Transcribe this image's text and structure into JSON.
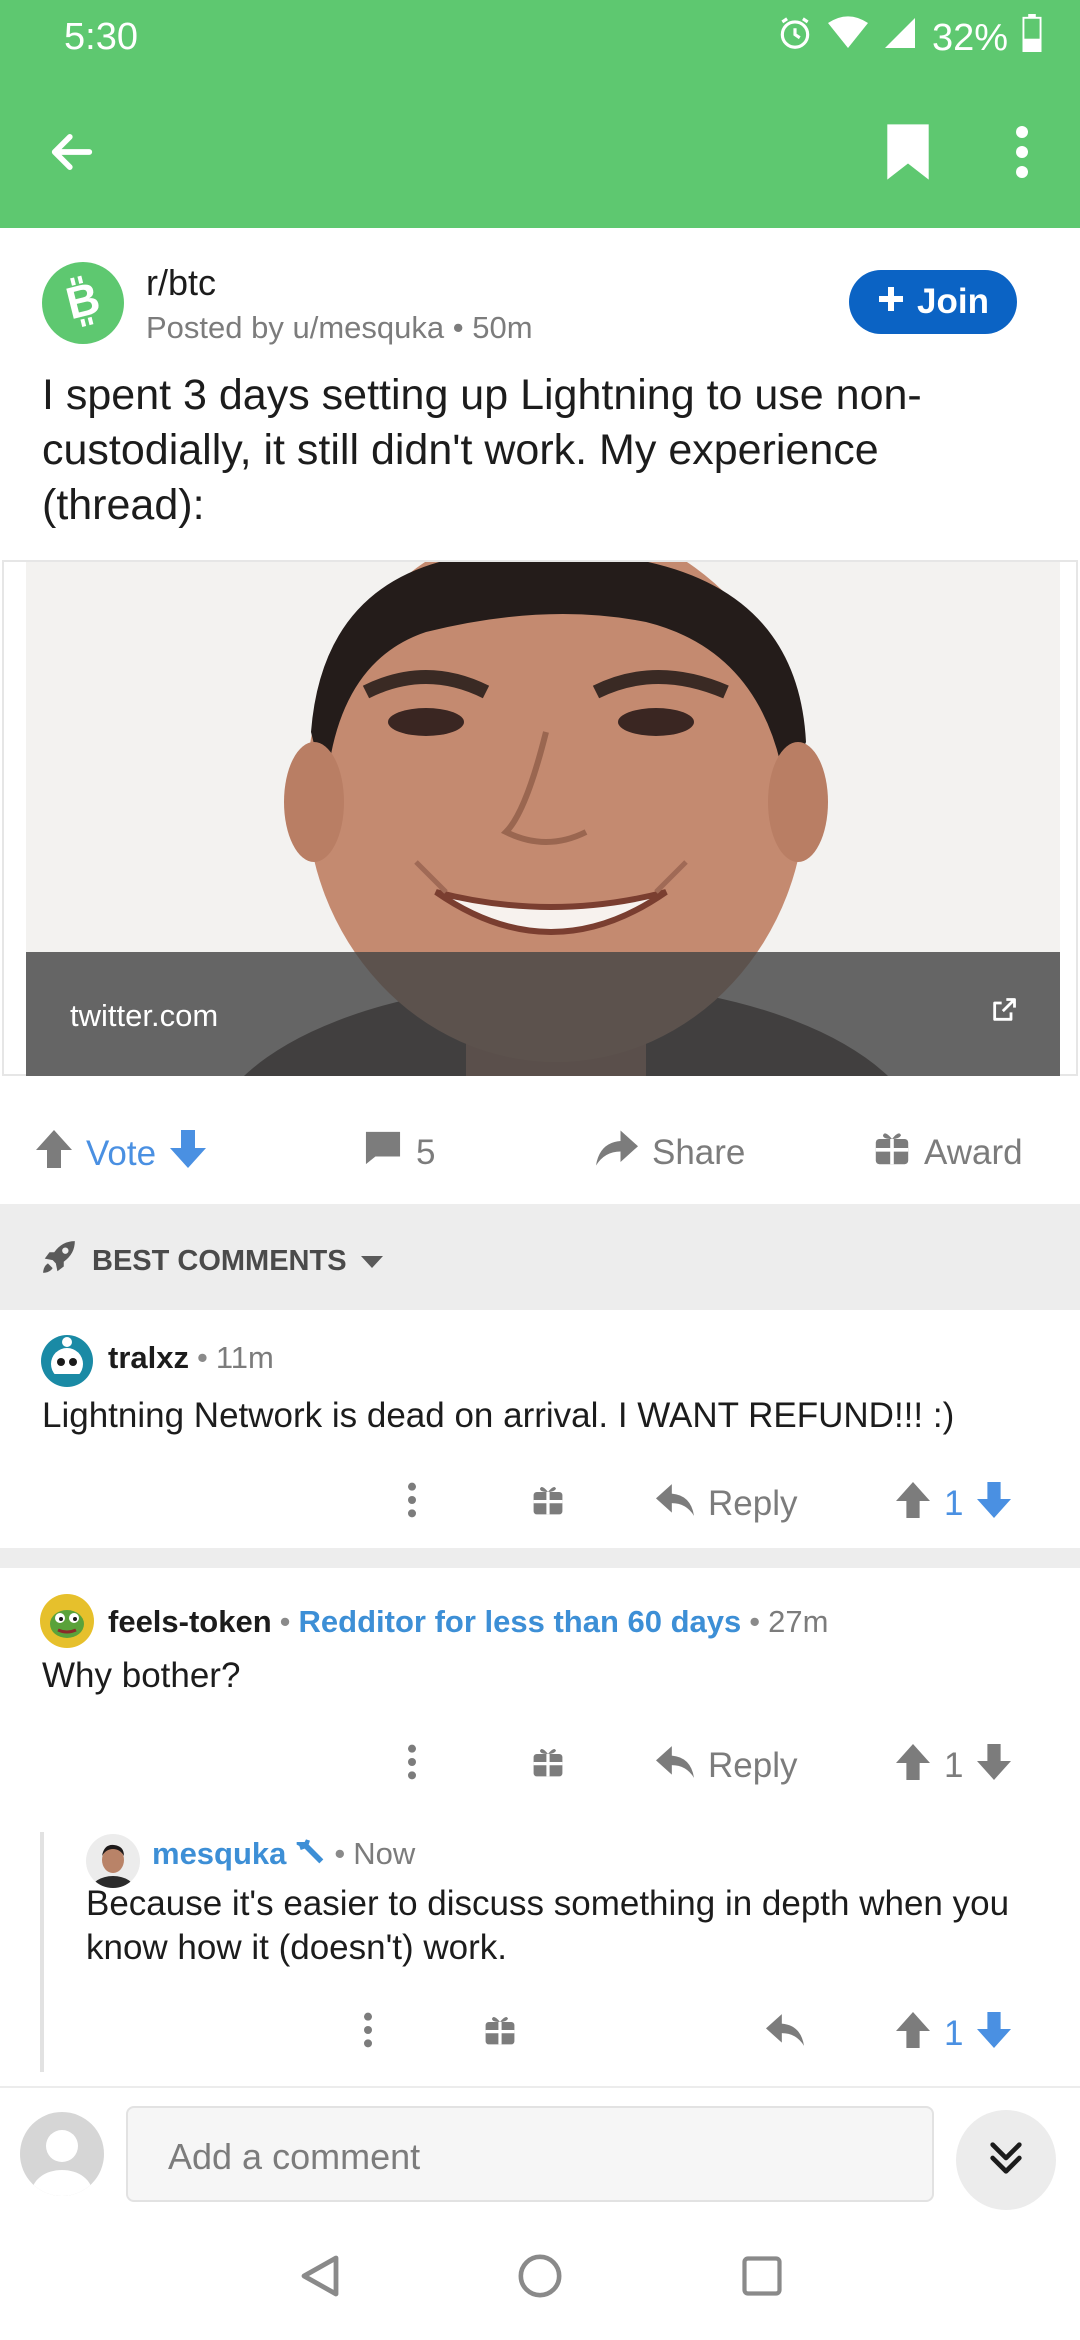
{
  "status_bar": {
    "time": "5:30",
    "battery": "32%",
    "icons": [
      "alarm-icon",
      "wifi-icon",
      "signal-icon",
      "battery-icon"
    ]
  },
  "toolbar": {
    "back_icon": "arrow-left-icon",
    "bookmark_icon": "bookmark-icon",
    "more_icon": "kebab-menu-icon",
    "background": "#5ec870"
  },
  "post": {
    "subreddit": "r/btc",
    "posted_by": "Posted by u/mesquka",
    "age": "50m",
    "join_label": "Join",
    "title": "I spent 3 days setting up Lightning to use non-custodially, it still didn't work. My experience (thread):",
    "link_domain": "twitter.com",
    "vote_label": "Vote",
    "comment_count": "5",
    "share_label": "Share",
    "award_label": "Award"
  },
  "sort": {
    "label": "BEST COMMENTS"
  },
  "comments": [
    {
      "author": "tralxz",
      "age": "11m",
      "body": "Lightning Network is dead on arrival. I WANT REFUND!!! :)",
      "reply_label": "Reply",
      "score": "1"
    },
    {
      "author": "feels-token",
      "flair": "Redditor for less than 60 days",
      "age": "27m",
      "body": "Why bother?",
      "reply_label": "Reply",
      "score": "1"
    },
    {
      "author": "mesquka",
      "age": "Now",
      "body": "Because it's easier to discuss something in depth when you know how it (doesn't) work.",
      "score": "1"
    }
  ],
  "composer": {
    "placeholder": "Add a comment"
  },
  "colors": {
    "accent_green": "#5ec870",
    "join_blue": "#0b63c4",
    "vote_blue": "#4a90e2",
    "flair_blue": "#3d8fd6"
  }
}
